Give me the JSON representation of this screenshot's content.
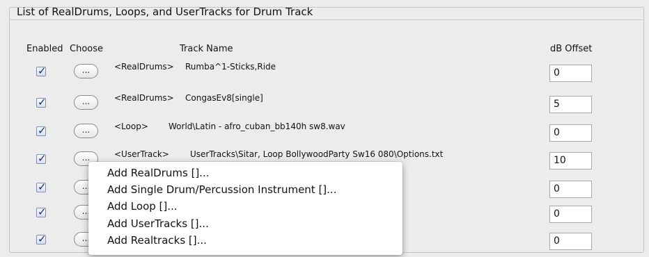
{
  "panel": {
    "title": "List of RealDrums, Loops, and UserTracks for Drum Track"
  },
  "headers": {
    "enabled": "Enabled",
    "choose": "Choose",
    "track_name": "Track Name",
    "db_offset": "dB Offset"
  },
  "rows": [
    {
      "enabled": true,
      "choose_label": "...",
      "type": "<RealDrums>",
      "name": "Rumba^1-Sticks,Ride",
      "db": "0"
    },
    {
      "enabled": true,
      "choose_label": "...",
      "type": "<RealDrums>",
      "name": "CongasEv8[single]",
      "db": "5"
    },
    {
      "enabled": true,
      "choose_label": "...",
      "type": "<Loop>",
      "name": "World\\Latin - afro_cuban_bb140h sw8.wav",
      "db": "0"
    },
    {
      "enabled": true,
      "choose_label": "...",
      "type": "<UserTrack>",
      "name": "UserTracks\\Sitar, Loop BollywoodParty Sw16 080\\Options.txt",
      "db": "10"
    },
    {
      "enabled": true,
      "choose_label": "...",
      "type": "",
      "name": "",
      "db": "0"
    },
    {
      "enabled": true,
      "choose_label": "...",
      "type": "",
      "name": "",
      "db": "0"
    },
    {
      "enabled": true,
      "choose_label": "...",
      "type": "",
      "name": "",
      "db": "0"
    }
  ],
  "context_menu": {
    "items": [
      "Add RealDrums []...",
      "Add Single Drum/Percussion Instrument []...",
      "Add Loop []...",
      "Add UserTracks []...",
      "Add Realtracks []..."
    ]
  },
  "colors": {
    "check_mark": "#1a2c78",
    "panel_bg": "#ececec",
    "menu_bg": "#ffffff"
  }
}
